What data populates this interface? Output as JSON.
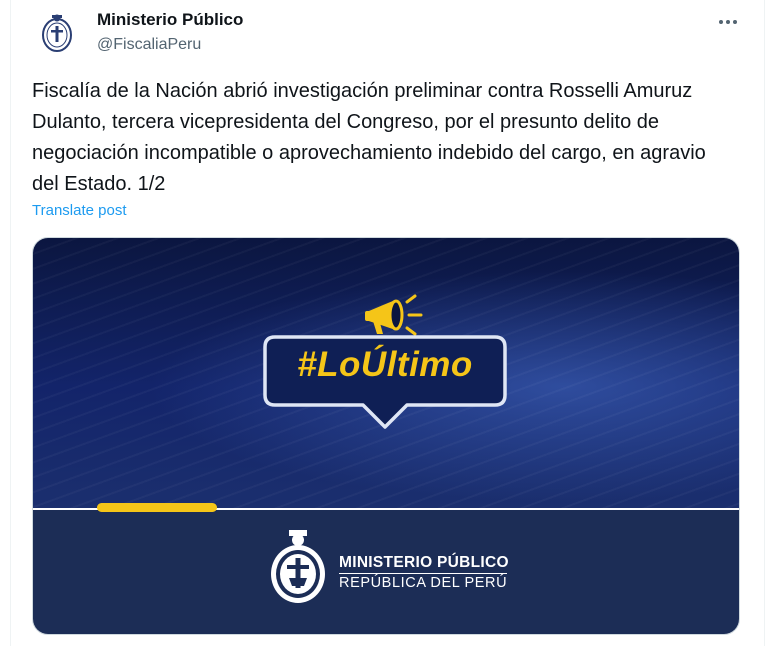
{
  "author": {
    "name": "Ministerio Público",
    "handle": "@FiscaliaPeru",
    "avatar_icon": "ministerio-publico-seal"
  },
  "more_icon": "more-horizontal-icon",
  "tweet": {
    "text": "Fiscalía de la Nación abrió investigación preliminar contra Rosselli Amuruz Dulanto, tercera vicepresidenta del Congreso, por el presunto delito de negociación incompatible o aprovechamiento indebido del cargo, en agravio del Estado. 1/2",
    "translate_label": "Translate post"
  },
  "media": {
    "hashtag": "#LoÚltimo",
    "org_name": "MINISTERIO PÚBLICO",
    "org_sub": "REPÚBLICA DEL PERÚ",
    "colors": {
      "accent": "#f5c518",
      "navy": "#1c2d56",
      "link": "#1d9bf0"
    }
  }
}
